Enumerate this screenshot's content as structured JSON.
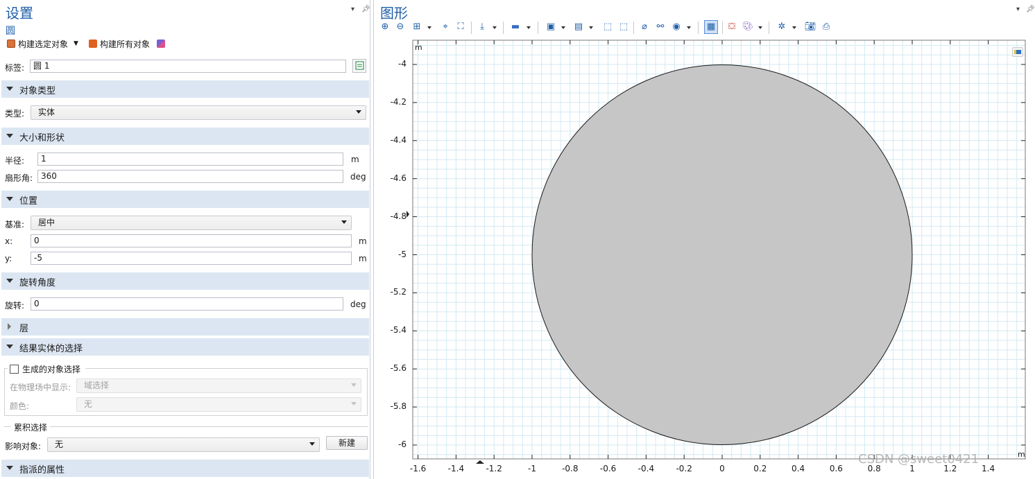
{
  "settings": {
    "title": "设置",
    "subtitle": "圆",
    "build_selected": "构建选定对象",
    "build_all": "构建所有对象",
    "label_label": "标签:",
    "label_value": "圆 1"
  },
  "object_type": {
    "header": "对象类型",
    "type_label": "类型:",
    "type_value": "实体"
  },
  "size_shape": {
    "header": "大小和形状",
    "radius_label": "半径:",
    "radius_value": "1",
    "radius_unit": "m",
    "sector_label": "扇形角:",
    "sector_value": "360",
    "sector_unit": "deg"
  },
  "position": {
    "header": "位置",
    "base_label": "基准:",
    "base_value": "居中",
    "x_label": "x:",
    "x_value": "0",
    "x_unit": "m",
    "y_label": "y:",
    "y_value": "-5",
    "y_unit": "m"
  },
  "rotation": {
    "header": "旋转角度",
    "rot_label": "旋转:",
    "rot_value": "0",
    "rot_unit": "deg"
  },
  "layers": {
    "header": "层"
  },
  "selection": {
    "header": "结果实体的选择",
    "generated_label": "生成的对象选择",
    "show_in_physics_label": "在物理场中显示:",
    "show_in_physics_value": "域选择",
    "color_label": "颜色:",
    "color_value": "无",
    "cumulative_label": "累积选择",
    "affect_label": "影响对象:",
    "affect_value": "无",
    "new_button": "新建"
  },
  "assigned": {
    "header": "指派的属性"
  },
  "graphics": {
    "title": "图形",
    "unit_top": "m",
    "unit_right": "m",
    "y_ticks": [
      "-4",
      "-4.2",
      "-4.4",
      "-4.6",
      "-4.8",
      "-5",
      "-5.2",
      "-5.4",
      "-5.6",
      "-5.8",
      "-6"
    ],
    "x_ticks": [
      "-1.6",
      "-1.4",
      "-1.2",
      "-1",
      "-0.8",
      "-0.6",
      "-0.4",
      "-0.2",
      "0",
      "0.2",
      "0.4",
      "0.6",
      "0.8",
      "1",
      "1.2",
      "1.4"
    ],
    "x_range": [
      -1.6,
      1.4
    ],
    "y_range": [
      -6,
      -4
    ],
    "circle": {
      "center_x": 0,
      "center_y": -5,
      "radius": 1
    },
    "circle_fill": "#c6c6c6",
    "grid_color": "#d4e9f2"
  },
  "watermark": "CSDN @sweet0421",
  "colors": {
    "accent": "#1f5fa8",
    "section_bg": "#dce6f3"
  }
}
